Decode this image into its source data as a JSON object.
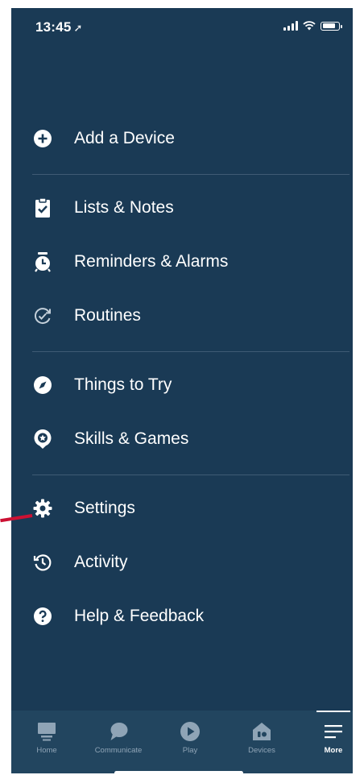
{
  "status_bar": {
    "time": "13:45",
    "location_glyph": "➚"
  },
  "menu": {
    "items": [
      {
        "label": "Add a Device",
        "icon": "add-circle-icon"
      },
      {
        "label": "Lists & Notes",
        "icon": "clipboard-check-icon"
      },
      {
        "label": "Reminders & Alarms",
        "icon": "alarm-clock-icon"
      },
      {
        "label": "Routines",
        "icon": "routines-icon"
      },
      {
        "label": "Things to Try",
        "icon": "compass-icon"
      },
      {
        "label": "Skills & Games",
        "icon": "skills-star-icon"
      },
      {
        "label": "Settings",
        "icon": "gear-icon"
      },
      {
        "label": "Activity",
        "icon": "history-icon"
      },
      {
        "label": "Help & Feedback",
        "icon": "help-icon"
      }
    ]
  },
  "tabbar": {
    "tabs": [
      {
        "label": "Home",
        "icon": "home-icon",
        "active": false
      },
      {
        "label": "Communicate",
        "icon": "chat-bubble-icon",
        "active": false
      },
      {
        "label": "Play",
        "icon": "play-icon",
        "active": false
      },
      {
        "label": "Devices",
        "icon": "devices-icon",
        "active": false
      },
      {
        "label": "More",
        "icon": "menu-lines-icon",
        "active": true
      }
    ]
  },
  "colors": {
    "background": "#1a3a55",
    "tabbar": "#22455f",
    "divider": "#3f5b74",
    "pointer": "#cc1133"
  }
}
